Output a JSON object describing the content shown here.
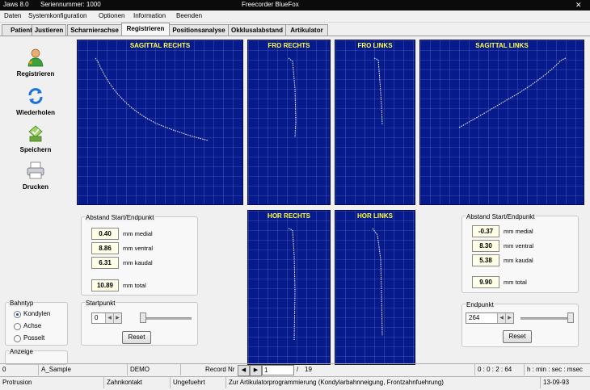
{
  "titlebar": {
    "app": "Jaws 8.0",
    "serial": "Seriennummer: 1000",
    "product": "Freecorder BlueFox"
  },
  "menu": [
    "Daten",
    "Systemkonfiguration",
    "Optionen",
    "Information",
    "Beenden"
  ],
  "tabs": [
    "Patient",
    "Justieren",
    "Scharnierachse",
    "Registrieren",
    "Positionsanalyse",
    "Okklusalabstand",
    "Artikulator"
  ],
  "active_tab": "Registrieren",
  "sidebar": {
    "registrieren": "Registrieren",
    "wiederholen": "Wiederholen",
    "speichern": "Speichern",
    "drucken": "Drucken"
  },
  "plots": {
    "sagittal_rechts": "SAGITTAL RECHTS",
    "fro_rechts": "FRO RECHTS",
    "fro_links": "FRO LINKS",
    "sagittal_links": "SAGITTAL LINKS",
    "hor_rechts": "HOR RECHTS",
    "hor_links": "HOR LINKS"
  },
  "left_panel": {
    "caption": "Abstand Start/Endpunkt",
    "medial": "0.40",
    "ventral": "8.86",
    "kaudal": "6.31",
    "total": "10.89",
    "medial_unit": "mm medial",
    "ventral_unit": "mm ventral",
    "kaudal_unit": "mm kaudal",
    "total_unit": "mm total"
  },
  "right_panel": {
    "caption": "Abstand Start/Endpunkt",
    "medial": "-0.37",
    "ventral": "8.30",
    "kaudal": "5.38",
    "total": "9.90",
    "medial_unit": "mm medial",
    "ventral_unit": "mm ventral",
    "kaudal_unit": "mm kaudal",
    "total_unit": "mm total"
  },
  "startpunkt": {
    "caption": "Startpunkt",
    "value": "0",
    "reset": "Reset",
    "slider_fraction": 0.0
  },
  "endpunkt": {
    "caption": "Endpunkt",
    "value": "264",
    "reset": "Reset",
    "slider_fraction": 1.0
  },
  "bahntyp": {
    "caption": "Bahntyp",
    "options": [
      "Kondylen",
      "Achse",
      "Posselt"
    ],
    "selected": "Kondylen"
  },
  "anzeige": {
    "caption": "Anzeige"
  },
  "status1": {
    "index": "0",
    "name": "A_Sample",
    "mode": "DEMO",
    "record_label": "Record Nr",
    "record": "1",
    "record_sep": "/",
    "record_total": "19",
    "time": "0 : 0 : 2 : 64",
    "time_format": "h : min : sec : msec"
  },
  "status2": {
    "protrusion": "Protrusion",
    "zahnkontakt": "Zahnkontakt",
    "ungefuehrt": "Ungefuehrt",
    "hint": "Zur Artikulatorprogrammierung (Kondylarbahnneigung, Frontzahnfuehrung)",
    "date": "13-09-93"
  },
  "colors": {
    "plot_bg": "#061a8c",
    "grid": "#6c7fd4",
    "title": "#ffff40",
    "trace": "#ffffff"
  }
}
